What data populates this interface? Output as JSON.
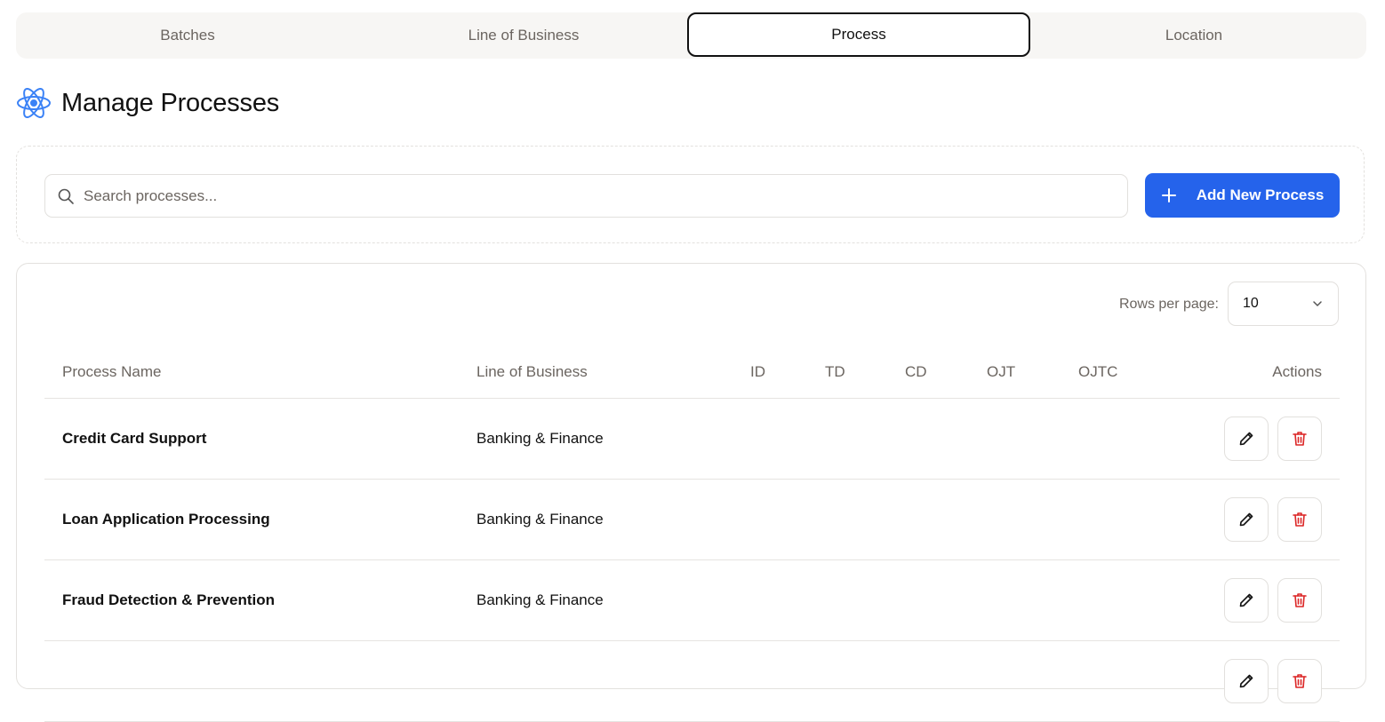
{
  "tabs": [
    {
      "label": "Batches",
      "active": false
    },
    {
      "label": "Line of Business",
      "active": false
    },
    {
      "label": "Process",
      "active": true
    },
    {
      "label": "Location",
      "active": false
    }
  ],
  "page": {
    "title": "Manage Processes",
    "icon": "atom-icon"
  },
  "search": {
    "placeholder": "Search processes...",
    "value": ""
  },
  "add_button": {
    "label": "Add New Process",
    "icon": "plus-icon",
    "color": "#2563eb"
  },
  "pagination": {
    "rows_per_page_label": "Rows per page:",
    "rows_per_page_value": "10"
  },
  "table": {
    "columns": [
      "Process Name",
      "Line of Business",
      "ID",
      "TD",
      "CD",
      "OJT",
      "OJTC",
      "Actions"
    ],
    "rows": [
      {
        "name": "Credit Card Support",
        "lob": "Banking & Finance"
      },
      {
        "name": "Loan Application Processing",
        "lob": "Banking & Finance"
      },
      {
        "name": "Fraud Detection & Prevention",
        "lob": "Banking & Finance"
      },
      {
        "name": "",
        "lob": ""
      }
    ],
    "action_icons": {
      "edit": "pencil-icon",
      "delete": "trash-icon"
    },
    "delete_color": "#dc2626"
  }
}
